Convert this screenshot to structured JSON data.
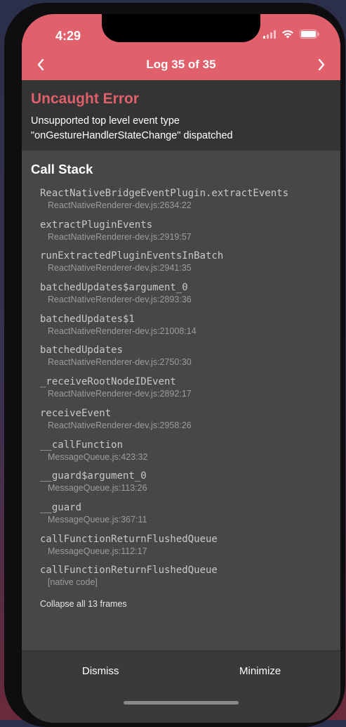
{
  "status_bar": {
    "time": "4:29"
  },
  "nav": {
    "title": "Log 35 of 35"
  },
  "error": {
    "title": "Uncaught Error",
    "message": "Unsupported top level event type \"onGestureHandlerStateChange\" dispatched"
  },
  "call_stack": {
    "title": "Call Stack",
    "frames": [
      {
        "fn": "ReactNativeBridgeEventPlugin.extractEvents",
        "loc": "ReactNativeRenderer-dev.js:2634:22"
      },
      {
        "fn": "extractPluginEvents",
        "loc": "ReactNativeRenderer-dev.js:2919:57"
      },
      {
        "fn": "runExtractedPluginEventsInBatch",
        "loc": "ReactNativeRenderer-dev.js:2941:35"
      },
      {
        "fn": "batchedUpdates$argument_0",
        "loc": "ReactNativeRenderer-dev.js:2893:36"
      },
      {
        "fn": "batchedUpdates$1",
        "loc": "ReactNativeRenderer-dev.js:21008:14"
      },
      {
        "fn": "batchedUpdates",
        "loc": "ReactNativeRenderer-dev.js:2750:30"
      },
      {
        "fn": "_receiveRootNodeIDEvent",
        "loc": "ReactNativeRenderer-dev.js:2892:17"
      },
      {
        "fn": "receiveEvent",
        "loc": "ReactNativeRenderer-dev.js:2958:26"
      },
      {
        "fn": "__callFunction",
        "loc": "MessageQueue.js:423:32"
      },
      {
        "fn": "__guard$argument_0",
        "loc": "MessageQueue.js:113:26"
      },
      {
        "fn": "__guard",
        "loc": "MessageQueue.js:367:11"
      },
      {
        "fn": "callFunctionReturnFlushedQueue",
        "loc": "MessageQueue.js:112:17"
      },
      {
        "fn": "callFunctionReturnFlushedQueue",
        "loc": "[native code]"
      }
    ],
    "collapse_label": "Collapse all 13 frames"
  },
  "footer": {
    "dismiss_label": "Dismiss",
    "minimize_label": "Minimize"
  },
  "colors": {
    "accent": "#e0606c",
    "background": "#474747",
    "error_bg": "#343434"
  }
}
